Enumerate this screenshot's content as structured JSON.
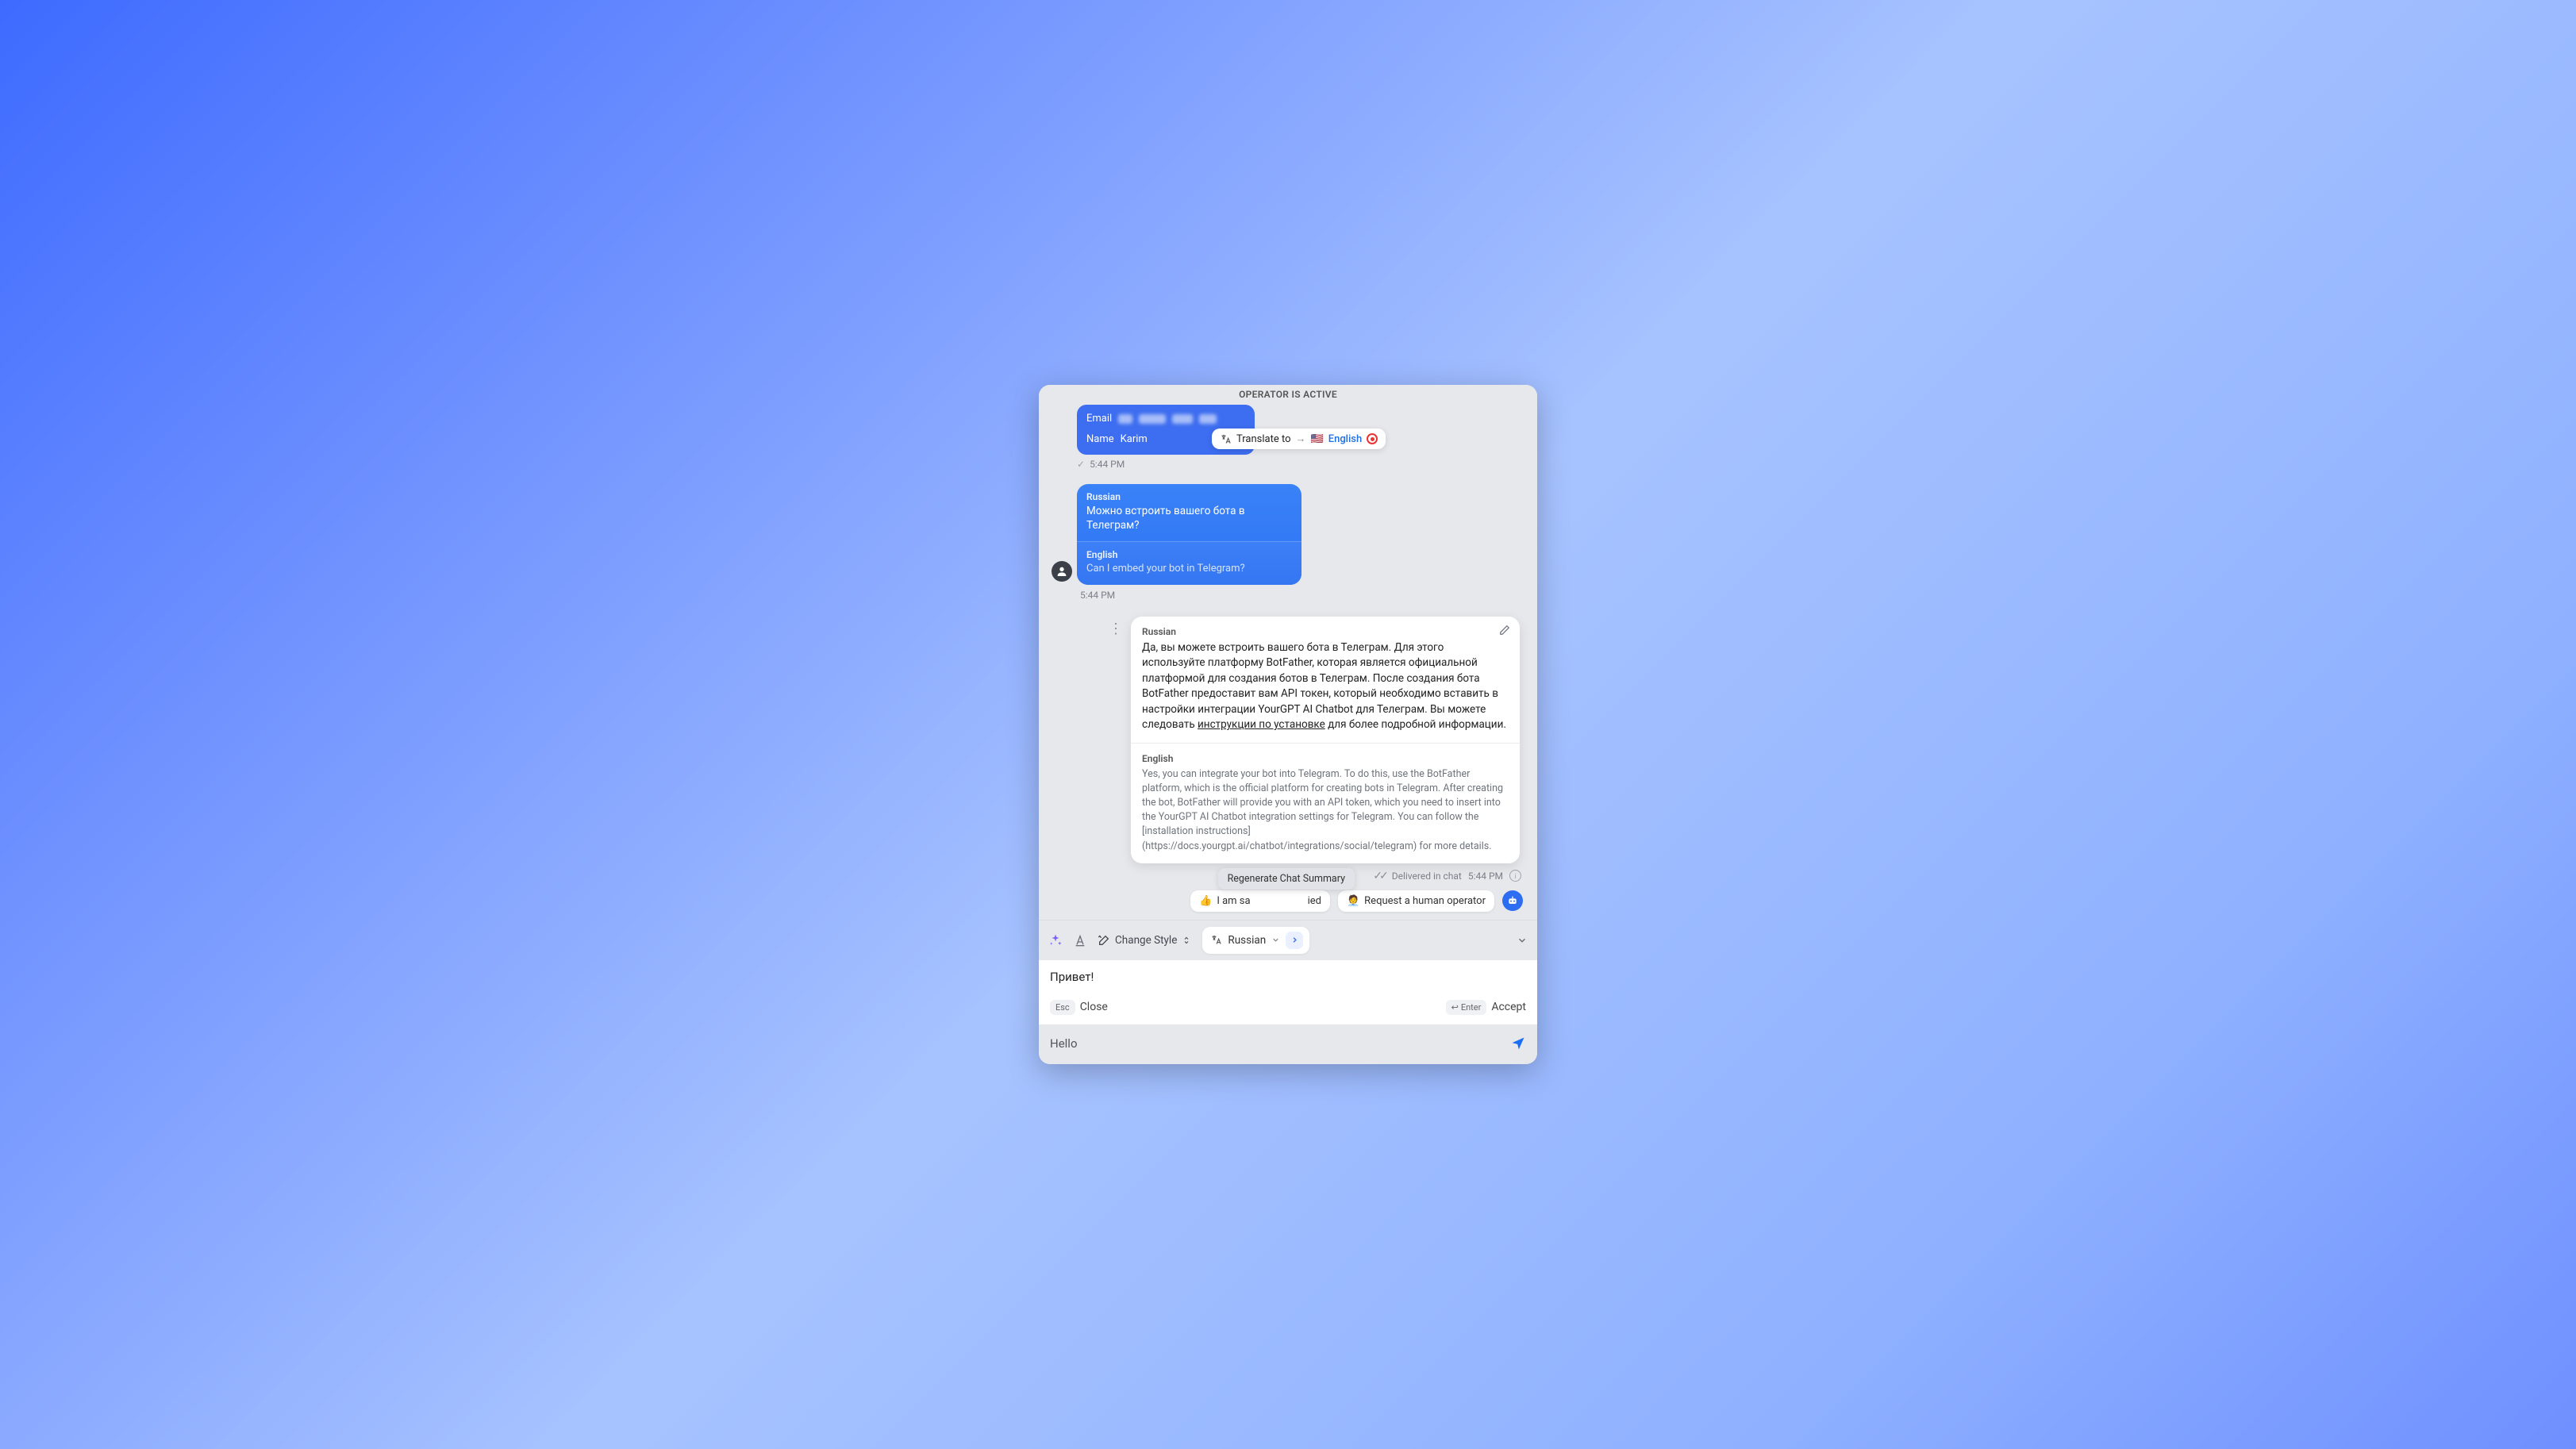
{
  "header": {
    "status": "OPERATOR IS ACTIVE"
  },
  "translate_popup": {
    "prefix": "Translate to",
    "flag": "🇺🇸",
    "language": "English"
  },
  "first_bubble": {
    "email_label": "Email",
    "name_label": "Name",
    "name_value": "Karim",
    "time": "5:44 PM"
  },
  "user_msg": {
    "lang1": "Russian",
    "text1": "Можно встроить вашего бота в Телеграм?",
    "lang2": "English",
    "text2": "Can I embed your bot in Telegram?",
    "time": "5:44 PM"
  },
  "bot_msg": {
    "lang1": "Russian",
    "text1_a": "Да, вы можете встроить вашего бота в Телеграм. Для этого используйте платформу BotFather, которая является официальной платформой для создания ботов в Телеграм. После создания бота BotFather предоставит вам API токен, который необходимо вставить в настройки интеграции YourGPT AI Chatbot для Телеграм. Вы можете следовать ",
    "link1": "инструкции по установке",
    "text1_b": " для более подробной информации.",
    "lang2": "English",
    "text2": "Yes, you can integrate your bot into Telegram. To do this, use the BotFather platform, which is the official platform for creating bots in Telegram. After creating the bot, BotFather will provide you with an API token, which you need to insert into the YourGPT AI Chatbot integration settings for Telegram. You can follow the [installation instructions](https://docs.yourgpt.ai/chatbot/integrations/social/telegram) for more details.",
    "delivered": "Delivered in chat",
    "time": "5:44 PM"
  },
  "chips": {
    "regenerate_tooltip": "Regenerate Chat Summary",
    "satisfied_emoji": "👍",
    "satisfied_visible": " I am sa",
    "satisfied_suffix": "ied",
    "human_emoji": "🧑‍💼",
    "human": "Request a human operator"
  },
  "toolbar": {
    "change_style": "Change Style",
    "language": "Russian"
  },
  "compose": {
    "typed": "Привет!",
    "esc_key": "Esc",
    "close": "Close",
    "enter_key": "Enter",
    "accept": "Accept"
  },
  "inputbar": {
    "placeholder": "Hello"
  }
}
